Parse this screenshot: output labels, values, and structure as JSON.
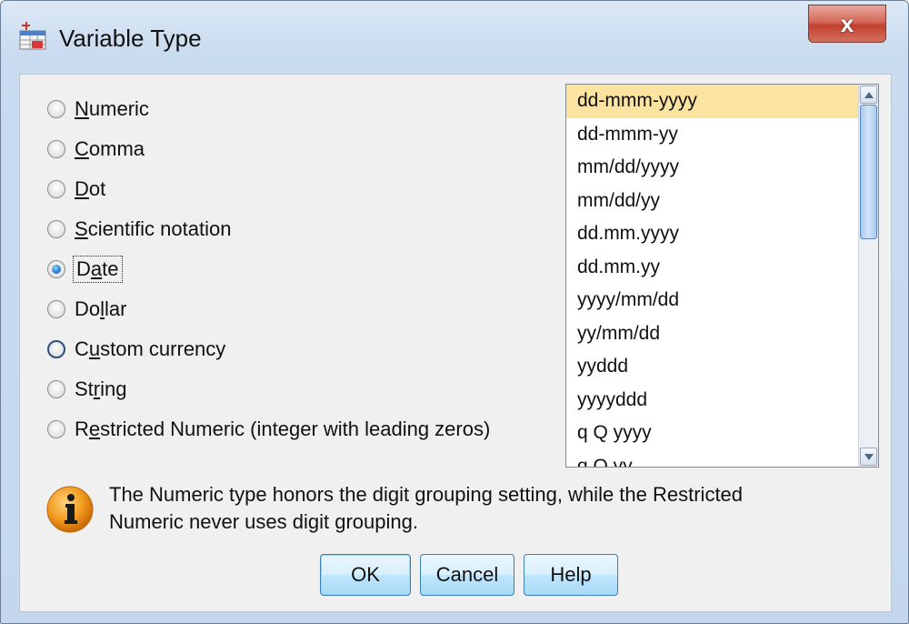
{
  "window": {
    "title": "Variable Type",
    "close_label": "x"
  },
  "radio_options": [
    {
      "pre": "",
      "mnemonic": "N",
      "post": "umeric",
      "selected": false
    },
    {
      "pre": "",
      "mnemonic": "C",
      "post": "omma",
      "selected": false
    },
    {
      "pre": "",
      "mnemonic": "D",
      "post": "ot",
      "selected": false
    },
    {
      "pre": "",
      "mnemonic": "S",
      "post": "cientific notation",
      "selected": false
    },
    {
      "pre": "D",
      "mnemonic": "a",
      "post": "te",
      "selected": true
    },
    {
      "pre": "Do",
      "mnemonic": "l",
      "post": "lar",
      "selected": false
    },
    {
      "pre": "C",
      "mnemonic": "u",
      "post": "stom currency",
      "selected": false
    },
    {
      "pre": "St",
      "mnemonic": "r",
      "post": "ing",
      "selected": false
    },
    {
      "pre": "R",
      "mnemonic": "e",
      "post": "stricted Numeric (integer with leading zeros)",
      "selected": false
    }
  ],
  "date_formats": {
    "items": [
      "dd-mmm-yyyy",
      "dd-mmm-yy",
      "mm/dd/yyyy",
      "mm/dd/yy",
      "dd.mm.yyyy",
      "dd.mm.yy",
      "yyyy/mm/dd",
      "yy/mm/dd",
      "yyddd",
      "yyyyddd",
      "q Q yyyy",
      "q Q yy"
    ],
    "selected_index": 0
  },
  "info": {
    "line1": "The Numeric type honors the digit grouping setting, while the Restricted",
    "line2": "Numeric never uses digit grouping."
  },
  "buttons": {
    "ok": "OK",
    "cancel": "Cancel",
    "help": "Help"
  },
  "colors": {
    "selection_highlight": "#fbe3a0",
    "button_border": "#3c7fb1",
    "close_button": "#c2402f"
  }
}
